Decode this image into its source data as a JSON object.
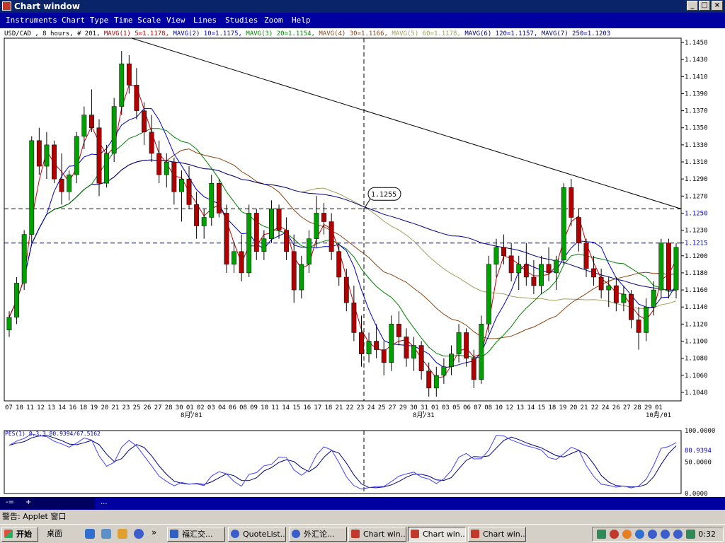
{
  "window": {
    "title": "Chart window",
    "min": "_",
    "max": "□",
    "close": "×"
  },
  "menu": [
    "Instruments",
    "Chart Type",
    "Time Scale",
    "View",
    "Lines",
    "Studies",
    "Zoom",
    "Help"
  ],
  "info_header": {
    "prefix": "USD/CAD , 8 hours, # 201,",
    "mavgs": [
      {
        "text": "MAVG(1) 5=1.1178,",
        "color": "#c00000"
      },
      {
        "text": "MAVG(2) 10=1.1175,",
        "color": "#0000c0"
      },
      {
        "text": "MAVG(3) 20=1.1154,",
        "color": "#008000"
      },
      {
        "text": "MAVG(4) 30=1.1166,",
        "color": "#8b4513"
      },
      {
        "text": "MAVG(5) 60=1.1178,",
        "color": "#a0a060"
      },
      {
        "text": "MAVG(6) 120=1.1157,",
        "color": "#000080"
      },
      {
        "text": "MAVG(7) 250=1.1203",
        "color": "#000080"
      }
    ]
  },
  "chart_data": {
    "type": "candlestick",
    "title": "USD/CAD , 8 hours, # 201",
    "y_ticks": [
      "1.1450",
      "1.1430",
      "1.1410",
      "1.1390",
      "1.1370",
      "1.1350",
      "1.1330",
      "1.1310",
      "1.1290",
      "1.1270",
      "1.1250",
      "1.1230",
      "1.1215",
      "1.1200",
      "1.1180",
      "1.1160",
      "1.1140",
      "1.1120",
      "1.1100",
      "1.1080",
      "1.1060",
      "1.1040"
    ],
    "ylim": [
      1.103,
      1.1455
    ],
    "x_ticks": [
      "07",
      "10",
      "11",
      "12",
      "13",
      "14",
      "16",
      "18",
      "19",
      "20",
      "21",
      "23",
      "25",
      "26",
      "27",
      "28",
      "30",
      "01",
      "02",
      "03",
      "04",
      "06",
      "08",
      "09",
      "10",
      "11",
      "14",
      "15",
      "16",
      "17",
      "18",
      "21",
      "22",
      "23",
      "24",
      "25",
      "27",
      "29",
      "30",
      "31",
      "01",
      "03",
      "05",
      "06",
      "07",
      "08",
      "10",
      "12",
      "13",
      "14",
      "15",
      "18",
      "19",
      "20",
      "21",
      "22",
      "24",
      "26",
      "27",
      "28",
      "29",
      "01"
    ],
    "month_labels": [
      "8月/01",
      "8月/31",
      "10月/01"
    ],
    "hlines": [
      {
        "value": 1.1255,
        "label": "1.1250",
        "color": "#000000"
      },
      {
        "value": 1.1215,
        "label": "1.1215",
        "color": "#0000c0"
      }
    ],
    "callout": "1.1255",
    "ma_values": {
      "MA5": 1.1178,
      "MA10": 1.1175,
      "MA20": 1.1154,
      "MA30": 1.1166,
      "MA60": 1.1178,
      "MA120": 1.1157,
      "MA250": 1.1203
    },
    "candles": [
      [
        1.1113,
        1.1135,
        1.1105,
        1.1128
      ],
      [
        1.1128,
        1.1175,
        1.112,
        1.1168
      ],
      [
        1.1168,
        1.123,
        1.116,
        1.1225
      ],
      [
        1.1225,
        1.134,
        1.1215,
        1.1335
      ],
      [
        1.1335,
        1.135,
        1.1295,
        1.1305
      ],
      [
        1.1305,
        1.1345,
        1.129,
        1.133
      ],
      [
        1.133,
        1.1335,
        1.1285,
        1.129
      ],
      [
        1.129,
        1.132,
        1.126,
        1.1275
      ],
      [
        1.1275,
        1.13,
        1.1265,
        1.1295
      ],
      [
        1.1295,
        1.1345,
        1.1285,
        1.134
      ],
      [
        1.134,
        1.1375,
        1.1325,
        1.1365
      ],
      [
        1.1365,
        1.1395,
        1.1345,
        1.135
      ],
      [
        1.135,
        1.136,
        1.127,
        1.1285
      ],
      [
        1.1285,
        1.133,
        1.128,
        1.132
      ],
      [
        1.132,
        1.1385,
        1.131,
        1.1375
      ],
      [
        1.1375,
        1.144,
        1.1365,
        1.1425
      ],
      [
        1.1425,
        1.1435,
        1.139,
        1.14
      ],
      [
        1.14,
        1.142,
        1.136,
        1.137
      ],
      [
        1.137,
        1.138,
        1.133,
        1.1345
      ],
      [
        1.1345,
        1.1365,
        1.131,
        1.132
      ],
      [
        1.132,
        1.1335,
        1.1285,
        1.1295
      ],
      [
        1.1295,
        1.132,
        1.128,
        1.131
      ],
      [
        1.131,
        1.1315,
        1.126,
        1.1275
      ],
      [
        1.1275,
        1.13,
        1.124,
        1.129
      ],
      [
        1.129,
        1.1305,
        1.1255,
        1.126
      ],
      [
        1.126,
        1.1275,
        1.122,
        1.1235
      ],
      [
        1.1235,
        1.1255,
        1.122,
        1.1245
      ],
      [
        1.1245,
        1.1295,
        1.1235,
        1.1285
      ],
      [
        1.1285,
        1.129,
        1.1245,
        1.125
      ],
      [
        1.125,
        1.126,
        1.118,
        1.119
      ],
      [
        1.119,
        1.1215,
        1.118,
        1.1205
      ],
      [
        1.1205,
        1.1225,
        1.117,
        1.118
      ],
      [
        1.118,
        1.126,
        1.1175,
        1.125
      ],
      [
        1.125,
        1.1255,
        1.1195,
        1.1205
      ],
      [
        1.1205,
        1.123,
        1.1195,
        1.122
      ],
      [
        1.122,
        1.1265,
        1.1215,
        1.1255
      ],
      [
        1.1255,
        1.126,
        1.122,
        1.123
      ],
      [
        1.123,
        1.1245,
        1.1195,
        1.1205
      ],
      [
        1.1205,
        1.1225,
        1.1145,
        1.116
      ],
      [
        1.116,
        1.12,
        1.115,
        1.119
      ],
      [
        1.119,
        1.123,
        1.118,
        1.122
      ],
      [
        1.122,
        1.127,
        1.121,
        1.125
      ],
      [
        1.125,
        1.1262,
        1.1225,
        1.124
      ],
      [
        1.124,
        1.125,
        1.1195,
        1.1205
      ],
      [
        1.1205,
        1.1215,
        1.1165,
        1.1175
      ],
      [
        1.1175,
        1.1185,
        1.1135,
        1.1145
      ],
      [
        1.1145,
        1.1165,
        1.11,
        1.111
      ],
      [
        1.111,
        1.113,
        1.107,
        1.1085
      ],
      [
        1.1085,
        1.111,
        1.1075,
        1.11
      ],
      [
        1.11,
        1.112,
        1.108,
        1.109
      ],
      [
        1.109,
        1.11,
        1.106,
        1.1075
      ],
      [
        1.1075,
        1.113,
        1.1065,
        1.112
      ],
      [
        1.112,
        1.1135,
        1.1095,
        1.1105
      ],
      [
        1.1105,
        1.1115,
        1.107,
        1.108
      ],
      [
        1.108,
        1.1105,
        1.1065,
        1.1095
      ],
      [
        1.1095,
        1.11,
        1.1055,
        1.1065
      ],
      [
        1.1065,
        1.1075,
        1.1035,
        1.1045
      ],
      [
        1.1045,
        1.107,
        1.1035,
        1.106
      ],
      [
        1.106,
        1.108,
        1.105,
        1.107
      ],
      [
        1.107,
        1.1095,
        1.106,
        1.1085
      ],
      [
        1.1085,
        1.112,
        1.1075,
        1.111
      ],
      [
        1.111,
        1.1115,
        1.107,
        1.108
      ],
      [
        1.108,
        1.109,
        1.1045,
        1.1055
      ],
      [
        1.1055,
        1.113,
        1.105,
        1.112
      ],
      [
        1.112,
        1.12,
        1.111,
        1.119
      ],
      [
        1.119,
        1.122,
        1.1175,
        1.121
      ],
      [
        1.121,
        1.1225,
        1.119,
        1.12
      ],
      [
        1.12,
        1.1215,
        1.117,
        1.118
      ],
      [
        1.118,
        1.12,
        1.116,
        1.119
      ],
      [
        1.119,
        1.1215,
        1.1165,
        1.1175
      ],
      [
        1.1175,
        1.1195,
        1.1155,
        1.1165
      ],
      [
        1.1165,
        1.12,
        1.1155,
        1.119
      ],
      [
        1.119,
        1.121,
        1.117,
        1.118
      ],
      [
        1.118,
        1.12,
        1.116,
        1.1195
      ],
      [
        1.1195,
        1.1285,
        1.119,
        1.128
      ],
      [
        1.128,
        1.129,
        1.1235,
        1.1245
      ],
      [
        1.1245,
        1.1255,
        1.1205,
        1.1215
      ],
      [
        1.1215,
        1.122,
        1.1175,
        1.1185
      ],
      [
        1.1185,
        1.12,
        1.1165,
        1.1175
      ],
      [
        1.1175,
        1.1185,
        1.115,
        1.116
      ],
      [
        1.116,
        1.1175,
        1.114,
        1.1165
      ],
      [
        1.1165,
        1.1175,
        1.1135,
        1.1145
      ],
      [
        1.1145,
        1.1165,
        1.1135,
        1.1155
      ],
      [
        1.1155,
        1.116,
        1.1115,
        1.1125
      ],
      [
        1.1125,
        1.114,
        1.109,
        1.111
      ],
      [
        1.111,
        1.115,
        1.11,
        1.114
      ],
      [
        1.114,
        1.117,
        1.113,
        1.116
      ],
      [
        1.116,
        1.122,
        1.115,
        1.1215
      ],
      [
        1.1215,
        1.122,
        1.115,
        1.116
      ],
      [
        1.116,
        1.1215,
        1.115,
        1.121
      ]
    ],
    "indicator": {
      "name": "PES(1) 8,3,3",
      "values": [
        "80.9394",
        "67.5162"
      ],
      "y_ticks": [
        "100.0000",
        "50.0000",
        "0.0000"
      ],
      "ylim": [
        0,
        100
      ]
    }
  },
  "bottom_toolbar": {
    "items": [
      "-=",
      "+",
      "..."
    ]
  },
  "status": "警告: Applet 窗口",
  "taskbar": {
    "start": "开始",
    "desktop": "桌面",
    "tasks": [
      "福汇交...",
      "QuoteList...",
      "外汇论...",
      "Chart win...",
      "Chart win...",
      "Chart win..."
    ],
    "clock": "0:32"
  },
  "colors": {
    "title_bar": "#0a246a",
    "menu_bar": "#0000a0",
    "bull": "#00a000",
    "bear": "#b00000",
    "chrome": "#d4d0c8"
  }
}
